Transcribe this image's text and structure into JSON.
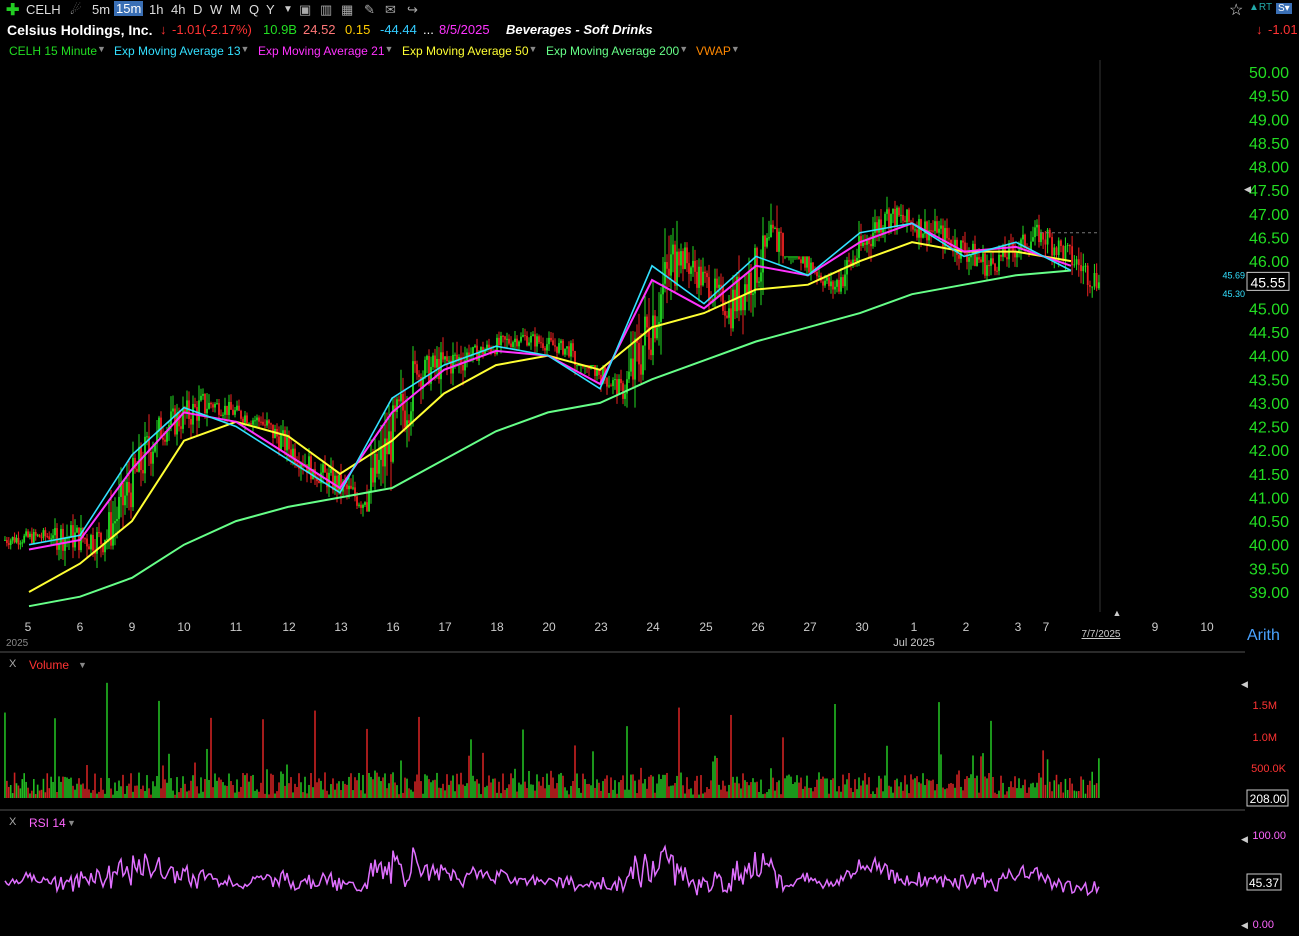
{
  "toolbar": {
    "symbol": "CELH",
    "timeframes": [
      "5m",
      "15m",
      "1h",
      "4h",
      "D",
      "W",
      "M",
      "Q",
      "Y"
    ],
    "active_timeframe": "15m",
    "rt_label": "RT",
    "s_label": "S"
  },
  "header": {
    "company": "Celsius Holdings, Inc.",
    "change": "-1.01",
    "change_pct": "(-2.17%)",
    "mktcap": "10.9B",
    "pe": "24.52",
    "v3": "0.15",
    "v4": "-44.44",
    "ellipsis": "...",
    "date": "8/5/2025",
    "sector": "Beverages - Soft Drinks",
    "right_change": "-1.01"
  },
  "legend": [
    {
      "label": "CELH 15 Minute",
      "color": "#22dd22"
    },
    {
      "label": "Exp Moving Average 13",
      "color": "#33e0ff"
    },
    {
      "label": "Exp Moving Average 21",
      "color": "#ff33ff"
    },
    {
      "label": "Exp Moving Average 50",
      "color": "#ffff33"
    },
    {
      "label": "Exp Moving Average 200",
      "color": "#66ff88"
    },
    {
      "label": "VWAP",
      "color": "#ff8800"
    }
  ],
  "chart_data": {
    "type": "candlestick",
    "y_ticks": [
      "50.00",
      "49.50",
      "49.00",
      "48.50",
      "48.00",
      "47.50",
      "47.00",
      "46.50",
      "46.00",
      "45.50",
      "45.00",
      "44.50",
      "44.00",
      "43.50",
      "43.00",
      "42.50",
      "42.00",
      "41.50",
      "41.00",
      "40.50",
      "40.00",
      "39.50",
      "39.00"
    ],
    "ylim": [
      38.9,
      50.2
    ],
    "x_ticks": [
      "5",
      "6",
      "9",
      "10",
      "11",
      "12",
      "13",
      "16",
      "17",
      "18",
      "20",
      "23",
      "24",
      "25",
      "26",
      "27",
      "30",
      "1",
      "2",
      "3",
      "7",
      "9",
      "10"
    ],
    "x_sublabel": "Jul 2025",
    "x_left_fragment": "2025",
    "cursor_date": "7/7/2025",
    "scale_mode": "Arith",
    "last_price": "45.55",
    "marker_high": "45.69",
    "marker_low": "45.30",
    "sessions_close": [
      {
        "day": "5",
        "open": 40.1,
        "close": 40.2,
        "low": 39.9,
        "high": 40.7
      },
      {
        "day": "6",
        "open": 40.2,
        "close": 40.1,
        "low": 39.3,
        "high": 41.1
      },
      {
        "day": "9",
        "open": 40.1,
        "close": 42.4,
        "low": 39.9,
        "high": 42.8
      },
      {
        "day": "10",
        "open": 42.4,
        "close": 43.0,
        "low": 42.1,
        "high": 44.0
      },
      {
        "day": "11",
        "open": 43.0,
        "close": 42.6,
        "low": 42.3,
        "high": 43.3
      },
      {
        "day": "12",
        "open": 42.6,
        "close": 41.6,
        "low": 41.3,
        "high": 42.8
      },
      {
        "day": "13",
        "open": 41.6,
        "close": 40.9,
        "low": 40.5,
        "high": 42.0
      },
      {
        "day": "16",
        "open": 40.9,
        "close": 43.6,
        "low": 40.7,
        "high": 44.2
      },
      {
        "day": "17",
        "open": 43.6,
        "close": 44.0,
        "low": 42.5,
        "high": 44.4
      },
      {
        "day": "18",
        "open": 44.0,
        "close": 44.4,
        "low": 43.8,
        "high": 44.8
      },
      {
        "day": "20",
        "open": 44.4,
        "close": 44.1,
        "low": 43.7,
        "high": 44.6
      },
      {
        "day": "23",
        "open": 44.1,
        "close": 43.2,
        "low": 42.6,
        "high": 43.8
      },
      {
        "day": "24",
        "open": 43.2,
        "close": 46.2,
        "low": 42.9,
        "high": 47.0
      },
      {
        "day": "25",
        "open": 46.2,
        "close": 45.0,
        "low": 44.6,
        "high": 46.4
      },
      {
        "day": "26",
        "open": 45.0,
        "close": 46.6,
        "low": 44.4,
        "high": 47.3
      },
      {
        "day": "27",
        "open": 46.6,
        "close": 45.4,
        "low": 45.0,
        "high": 46.1
      },
      {
        "day": "30",
        "open": 45.4,
        "close": 47.0,
        "low": 45.3,
        "high": 47.2
      },
      {
        "day": "1",
        "open": 47.0,
        "close": 46.6,
        "low": 46.2,
        "high": 47.7
      },
      {
        "day": "2",
        "open": 46.6,
        "close": 45.9,
        "low": 45.3,
        "high": 46.9
      },
      {
        "day": "3",
        "open": 45.9,
        "close": 46.6,
        "low": 45.7,
        "high": 47.0
      },
      {
        "day": "7",
        "open": 46.6,
        "close": 45.55,
        "low": 45.1,
        "high": 46.7
      }
    ],
    "ema13_pts": [
      40.0,
      40.2,
      41.9,
      42.9,
      42.5,
      41.8,
      41.1,
      43.1,
      43.8,
      44.2,
      44.0,
      43.3,
      45.9,
      45.1,
      46.1,
      45.7,
      46.6,
      46.8,
      46.1,
      46.4,
      45.8
    ],
    "ema21_pts": [
      39.9,
      40.1,
      41.6,
      42.8,
      42.6,
      41.9,
      41.2,
      42.8,
      43.7,
      44.1,
      44.0,
      43.4,
      45.6,
      45.0,
      45.9,
      45.7,
      46.4,
      46.8,
      46.2,
      46.3,
      45.9
    ],
    "ema50_pts": [
      39.0,
      39.6,
      40.5,
      42.2,
      42.6,
      42.3,
      41.5,
      42.2,
      43.2,
      43.8,
      44.0,
      43.7,
      44.6,
      44.9,
      45.4,
      45.5,
      46.0,
      46.4,
      46.2,
      46.2,
      46.0
    ],
    "ema200_pts": [
      38.7,
      38.9,
      39.3,
      40.0,
      40.5,
      40.8,
      41.0,
      41.2,
      41.8,
      42.4,
      42.8,
      43.0,
      43.5,
      43.9,
      44.3,
      44.6,
      44.9,
      45.3,
      45.5,
      45.7,
      45.8
    ]
  },
  "volume": {
    "label": "Volume",
    "ticks": [
      "1.5M",
      "1.0M",
      "500.0K"
    ],
    "last": "208.00"
  },
  "rsi": {
    "label": "RSI 14",
    "ticks": [
      "100.00",
      "0.00"
    ],
    "last": "45.37"
  }
}
